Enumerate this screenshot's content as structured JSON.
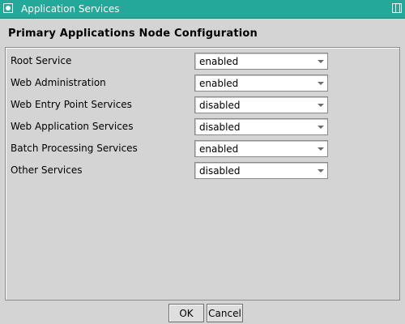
{
  "window": {
    "title": "Application Services"
  },
  "heading": "Primary Applications Node Configuration",
  "settings": [
    {
      "label": "Root Service",
      "value": "enabled"
    },
    {
      "label": "Web Administration",
      "value": "enabled"
    },
    {
      "label": "Web Entry Point Services",
      "value": "disabled"
    },
    {
      "label": "Web Application Services",
      "value": "disabled"
    },
    {
      "label": "Batch Processing Services",
      "value": "enabled"
    },
    {
      "label": "Other Services",
      "value": "disabled"
    }
  ],
  "buttons": {
    "ok_label": "OK",
    "cancel_label": "Cancel"
  },
  "colors": {
    "titlebar": "#23a89a",
    "background": "#d4d4d4"
  }
}
